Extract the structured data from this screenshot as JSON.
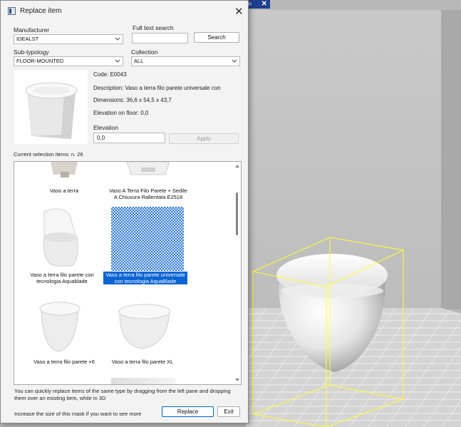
{
  "dialog": {
    "title": "Replace item",
    "manufacturer_label": "Manufacturer",
    "manufacturer_value": "IDEALST",
    "fulltext_label": "Full text search",
    "fulltext_value": "",
    "search_button": "Search",
    "subtypology_label": "Sub-typology",
    "subtypology_value": "FLOOR-MOUNTED",
    "collection_label": "Collection",
    "collection_value": "ALL",
    "code": "Code: E0043",
    "description": "Description: Vaso a terra filo parete universale con",
    "dimensions": "Dimensions: 36,6 x 54,5 x 43,7",
    "elevation_on_floor": "Elevation on floor: 0,0",
    "elevation_label": "Elevation",
    "elevation_value": "0,0",
    "apply_button": "Apply",
    "selection_count": "Current selection items: n. 26",
    "items": [
      {
        "caption": "Vaso a terra"
      },
      {
        "caption": "Vaso A Terra Filo Parete + Sedile A Chiusura Rallentata E2518"
      },
      {
        "caption": "Vaso a terra filo parete con tecnologia Aquablade"
      },
      {
        "caption": "Vaso a terra filo parete universale con tecnologia AquaBlade"
      },
      {
        "caption": "Vaso a terra filo parete +6"
      },
      {
        "caption": "Vaso a terra filo parete XL"
      }
    ],
    "hint": "You can quickly replace items of the same type by dragging from the left pane and dropping them over an existing item, while in 3D",
    "size_hint": "Increase the size of this mask if you want to see more",
    "replace_button": "Replace",
    "exit_button": "Exit"
  },
  "background_tab": {
    "label": "on"
  },
  "colors": {
    "accent": "#0067c0",
    "selection": "#0a64d2",
    "bbox": "#ffff33"
  }
}
